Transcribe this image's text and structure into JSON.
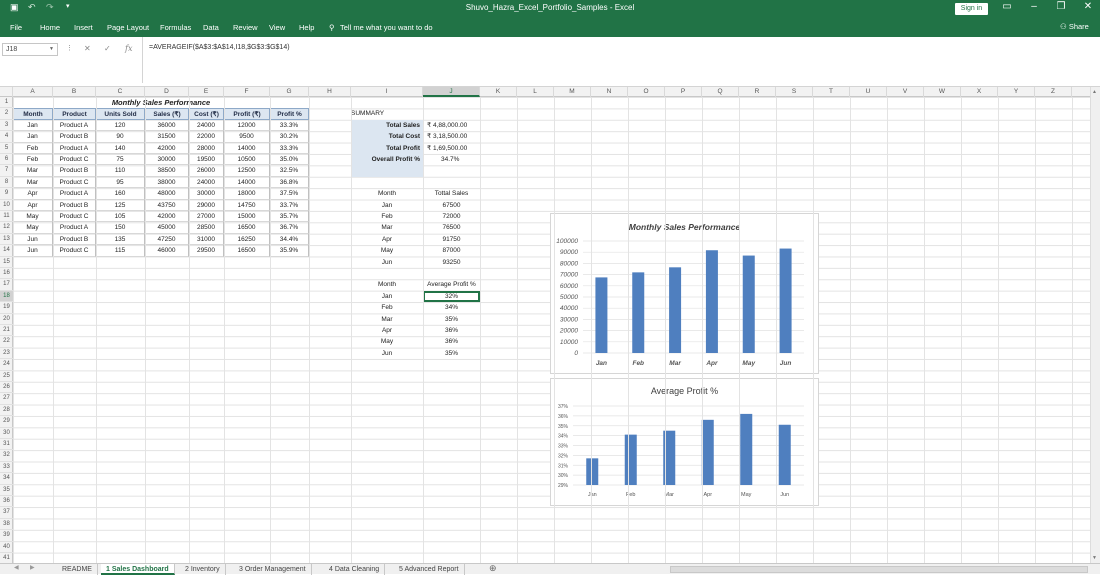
{
  "window": {
    "title": "Shuvo_Hazra_Excel_Portfolio_Samples  -  Excel",
    "sign_in": "Sign in"
  },
  "ribbon": {
    "tabs": [
      "File",
      "Home",
      "Insert",
      "Page Layout",
      "Formulas",
      "Data",
      "Review",
      "View",
      "Help"
    ],
    "tell_me": "Tell me what you want to do",
    "share": "Share"
  },
  "formula_bar": {
    "name_box": "J18",
    "formula": "=AVERAGEIF($A$3:$A$14,I18,$G$3:$G$14)"
  },
  "columns": [
    "A",
    "B",
    "C",
    "D",
    "E",
    "F",
    "G",
    "H",
    "I",
    "J",
    "K",
    "L",
    "M",
    "N",
    "O",
    "P",
    "Q",
    "R",
    "S",
    "T",
    "U",
    "V",
    "W",
    "X",
    "Y",
    "Z"
  ],
  "selected": {
    "col": "J",
    "row": 18
  },
  "sales_table": {
    "title": "Monthly Sales Performance",
    "headers": [
      "Month",
      "Product",
      "Units Sold",
      "Sales (₹)",
      "Cost (₹)",
      "Profit (₹)",
      "Profit %"
    ],
    "rows": [
      [
        "Jan",
        "Product A",
        "120",
        "36000",
        "24000",
        "12000",
        "33.3%"
      ],
      [
        "Jan",
        "Product B",
        "90",
        "31500",
        "22000",
        "9500",
        "30.2%"
      ],
      [
        "Feb",
        "Product A",
        "140",
        "42000",
        "28000",
        "14000",
        "33.3%"
      ],
      [
        "Feb",
        "Product C",
        "75",
        "30000",
        "19500",
        "10500",
        "35.0%"
      ],
      [
        "Mar",
        "Product B",
        "110",
        "38500",
        "26000",
        "12500",
        "32.5%"
      ],
      [
        "Mar",
        "Product C",
        "95",
        "38000",
        "24000",
        "14000",
        "36.8%"
      ],
      [
        "Apr",
        "Product A",
        "160",
        "48000",
        "30000",
        "18000",
        "37.5%"
      ],
      [
        "Apr",
        "Product B",
        "125",
        "43750",
        "29000",
        "14750",
        "33.7%"
      ],
      [
        "May",
        "Product C",
        "105",
        "42000",
        "27000",
        "15000",
        "35.7%"
      ],
      [
        "May",
        "Product A",
        "150",
        "45000",
        "28500",
        "16500",
        "36.7%"
      ],
      [
        "Jun",
        "Product B",
        "135",
        "47250",
        "31000",
        "16250",
        "34.4%"
      ],
      [
        "Jun",
        "Product C",
        "115",
        "46000",
        "29500",
        "16500",
        "35.9%"
      ]
    ]
  },
  "summary": {
    "title": "SUMMARY",
    "items": [
      {
        "label": "Total Sales",
        "value": "₹ 4,88,000.00"
      },
      {
        "label": "Total Cost",
        "value": "₹ 3,18,500.00"
      },
      {
        "label": "Total Profit",
        "value": "₹ 1,69,500.00"
      },
      {
        "label": "Overall Profit %",
        "value": "34.7%"
      }
    ]
  },
  "monthly_sales": {
    "headers": [
      "Month",
      "Tottal Sales"
    ],
    "rows": [
      [
        "Jan",
        "67500"
      ],
      [
        "Feb",
        "72000"
      ],
      [
        "Mar",
        "76500"
      ],
      [
        "Apr",
        "91750"
      ],
      [
        "May",
        "87000"
      ],
      [
        "Jun",
        "93250"
      ]
    ]
  },
  "avg_profit": {
    "headers": [
      "Month",
      "Average Profit %"
    ],
    "rows": [
      [
        "Jan",
        "32%"
      ],
      [
        "Feb",
        "34%"
      ],
      [
        "Mar",
        "35%"
      ],
      [
        "Apr",
        "36%"
      ],
      [
        "May",
        "36%"
      ],
      [
        "Jun",
        "35%"
      ]
    ]
  },
  "sheet_tabs": [
    "README",
    "1 Sales Dashboard",
    "2 Inventory",
    "3 Order Management",
    "4 Data Cleaning",
    "5 Advanced Report"
  ],
  "active_tab": 1,
  "chart_data": [
    {
      "type": "bar",
      "title": "Monthly Sales Performance",
      "categories": [
        "Jan",
        "Feb",
        "Mar",
        "Apr",
        "May",
        "Jun"
      ],
      "values": [
        67500,
        72000,
        76500,
        91750,
        87000,
        93250
      ],
      "ylim": [
        0,
        100000
      ],
      "yticks": [
        "0",
        "10000",
        "20000",
        "30000",
        "40000",
        "50000",
        "60000",
        "70000",
        "80000",
        "90000",
        "100000"
      ],
      "grid": true,
      "color": "#4f7fbf"
    },
    {
      "type": "bar",
      "title": "Average Profit %",
      "categories": [
        "Jan",
        "Feb",
        "Mar",
        "Apr",
        "May",
        "Jun"
      ],
      "values": [
        31.7,
        34.1,
        34.5,
        35.6,
        36.2,
        35.1
      ],
      "ylim": [
        29,
        37
      ],
      "yticks": [
        "29%",
        "30%",
        "31%",
        "32%",
        "33%",
        "34%",
        "35%",
        "36%",
        "37%"
      ],
      "grid": true,
      "color": "#4f7fbf"
    }
  ]
}
